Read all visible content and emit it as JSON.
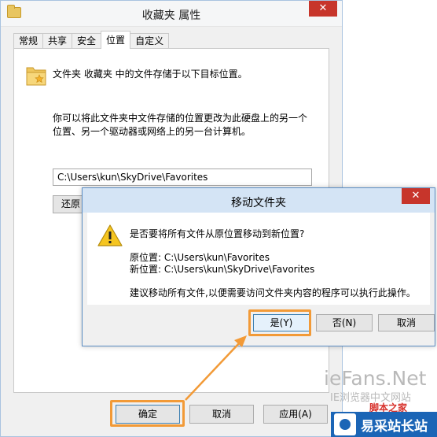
{
  "window": {
    "title": "收藏夹 属性",
    "close_label": "✕",
    "tabs": [
      {
        "label": "常规"
      },
      {
        "label": "共享"
      },
      {
        "label": "安全"
      },
      {
        "label": "位置"
      },
      {
        "label": "自定义"
      }
    ],
    "active_tab": "位置",
    "location_line": "文件夹 收藏夹 中的文件存储于以下目标位置。",
    "description_line1": "你可以将此文件夹中文件存储的位置更改为此硬盘上的另一个",
    "description_line2": "位置、另一个驱动器或网络上的另一台计算机。",
    "path_value": "C:\\Users\\kun\\SkyDrive\\Favorites",
    "restore_label": "还原",
    "ok_label": "确定",
    "cancel_label": "取消",
    "apply_label": "应用(A)"
  },
  "dialog": {
    "title": "移动文件夹",
    "close_label": "✕",
    "question": "是否要将所有文件从原位置移动到新位置?",
    "original_location": "原位置: C:\\Users\\kun\\Favorites",
    "new_location": "新位置: C:\\Users\\kun\\SkyDrive\\Favorites",
    "note": "建议移动所有文件,以便需要访问文件夹内容的程序可以执行此操作。",
    "yes_label": "是(Y)",
    "no_label": "否(N)",
    "cancel_label": "取消"
  },
  "watermark": {
    "main": "iеFans.Net",
    "sub": "IE浏览器中文网站",
    "red": "脚本之家",
    "site": "易采站长站"
  },
  "colors": {
    "highlight": "#f29a37",
    "close_button": "#c7352b",
    "dialog_title_bg": "#d4e4f5",
    "site_badge": "#1b65b6"
  }
}
